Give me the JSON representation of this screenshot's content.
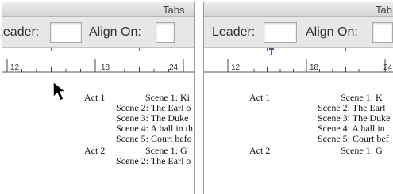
{
  "left": {
    "title": "Tabs",
    "leader_label": "Leader:",
    "align_on_label": "Align On:",
    "ruler": {
      "labels": [
        "12",
        "18",
        "24"
      ]
    },
    "doc": {
      "act1": "Act 1",
      "act1_scene1": "Scene 1: Ki",
      "act1_scene2": "Scene 2: The Earl o",
      "act1_scene3": "Scene 3: The Duke",
      "act1_scene4": "Scene 4: A hall in th",
      "act1_scene5": "Scene 5: Court befo",
      "act2": "Act 2",
      "act2_scene1": "Scene 1: G",
      "act2_scene2": "Scene 2: The Earl o"
    }
  },
  "right": {
    "title": "Tab",
    "leader_label": "Leader:",
    "align_on_label": "Align On:",
    "ruler": {
      "labels": [
        "12",
        "18",
        "24"
      ]
    },
    "doc": {
      "act1": "Act 1",
      "act1_scene1": "Scene 1: K",
      "act1_scene2": "Scene 2: The Earl",
      "act1_scene3": "Scene 3: The Duke",
      "act1_scene4": "Scene 4: A hall in",
      "act1_scene5": "Scene 5: Court bef",
      "act2": "Act 2",
      "act2_scene1": "Scene 1: G"
    }
  },
  "colors": {
    "tab_marker": "#3a5a9c"
  },
  "icons": {
    "pointer": "arrow-cursor-icon",
    "tab_stop": "tab-stop-icon"
  }
}
